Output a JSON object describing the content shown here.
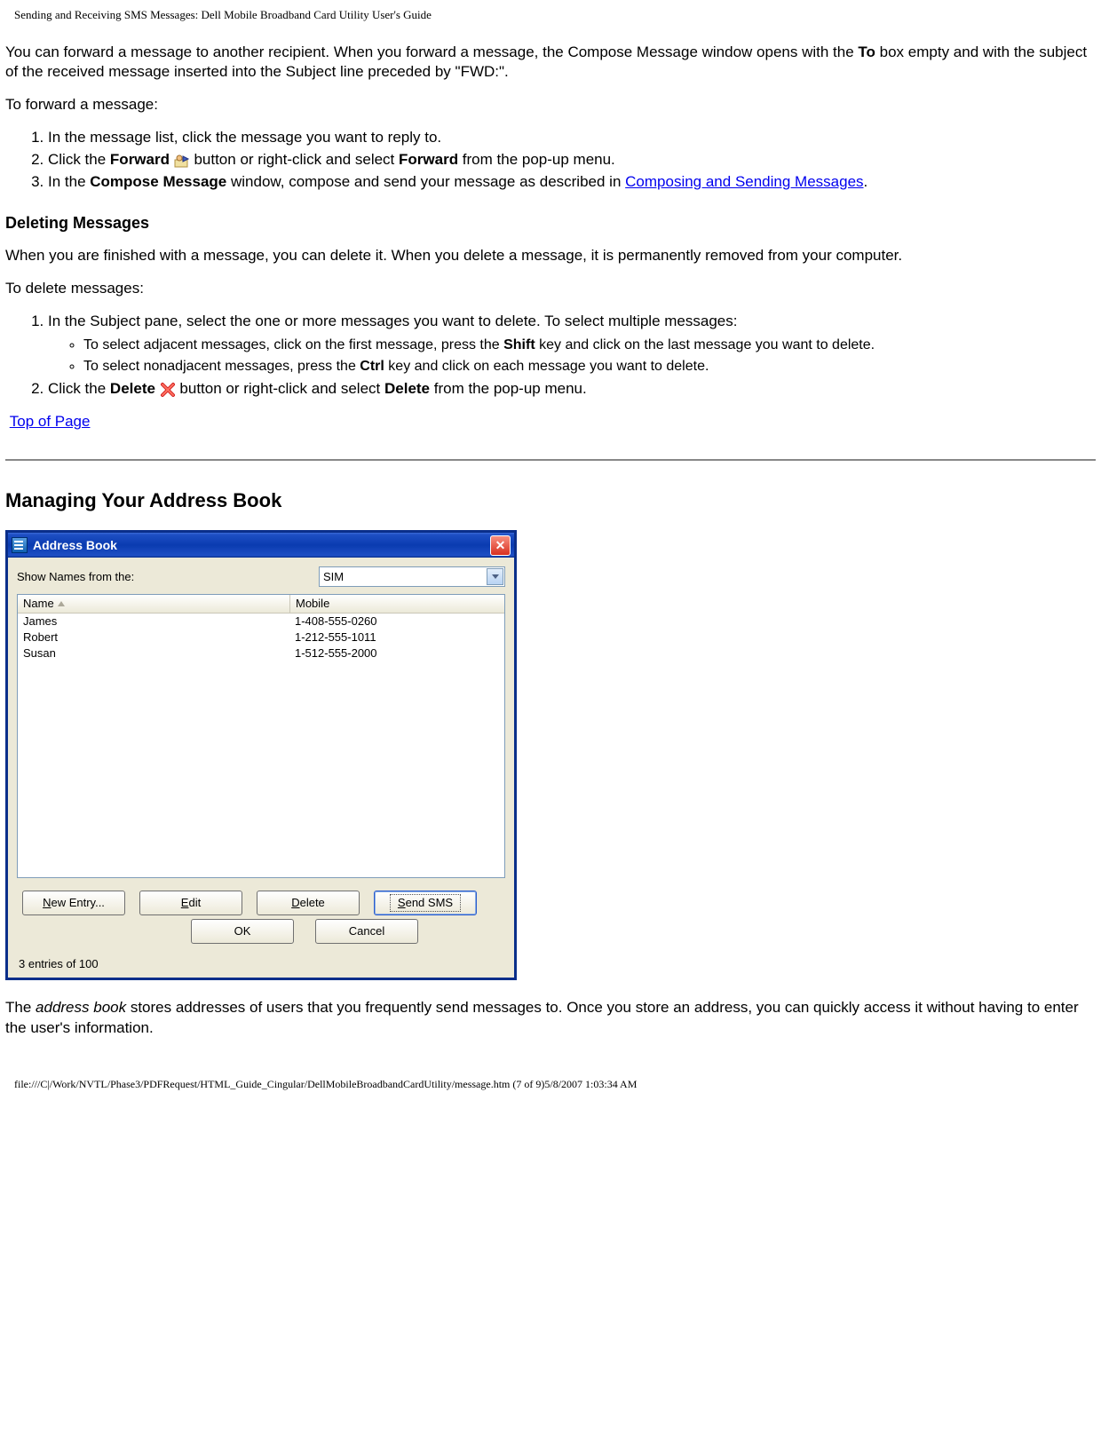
{
  "header": "Sending and Receiving SMS Messages: Dell Mobile Broadband Card Utility User's Guide",
  "p1_1": "You can forward a message to another recipient. When you forward a message, the Compose Message window opens with the ",
  "p1_bold": "To",
  "p1_2": " box empty and with the subject of the received message inserted into the Subject line preceded by \"FWD:\".",
  "p2": "To forward a message:",
  "fwd_steps": {
    "s1": "In the message list, click the message you want to reply to.",
    "s2_a": "Click the ",
    "s2_b1": "Forward",
    "s2_c": " button or right-click and select ",
    "s2_b2": "Forward",
    "s2_d": " from the pop-up menu.",
    "s3_a": "In the ",
    "s3_b": "Compose Message",
    "s3_c": " window, compose and send your message as described in ",
    "s3_link": "Composing and Sending Messages",
    "s3_d": "."
  },
  "h_delete": "Deleting Messages",
  "del_p1": "When you are finished with a message, you can delete it. When you delete a message, it is permanently removed from your computer.",
  "del_p2": "To delete messages:",
  "del_steps": {
    "s1": "In the Subject pane, select the one or more messages you want to delete. To select multiple messages:",
    "s1a_1": "To select adjacent messages, click on the first message, press the ",
    "s1a_b": "Shift",
    "s1a_2": " key and click on the last message you want to delete.",
    "s1b_1": "To select nonadjacent messages, press the ",
    "s1b_b": "Ctrl",
    "s1b_2": " key and click on each message you want to delete.",
    "s2_a": "Click the ",
    "s2_b1": "Delete",
    "s2_c": " button or right-click and select ",
    "s2_b2": "Delete",
    "s2_d": " from the pop-up menu."
  },
  "top_link": "Top of Page",
  "h_addressbook": "Managing Your Address Book",
  "ab": {
    "title": "Address Book",
    "show_label": "Show Names from the:",
    "select_val": "SIM",
    "col_name": "Name",
    "col_mobile": "Mobile",
    "rows": [
      {
        "name": "James",
        "mobile": "1-408-555-0260"
      },
      {
        "name": "Robert",
        "mobile": "1-212-555-1011"
      },
      {
        "name": "Susan",
        "mobile": "1-512-555-2000"
      }
    ],
    "btn_new_u": "N",
    "btn_new": "ew Entry...",
    "btn_edit_u": "E",
    "btn_edit": "dit",
    "btn_delete_u": "D",
    "btn_delete": "elete",
    "btn_send_u": "S",
    "btn_send": "end SMS",
    "btn_ok": "OK",
    "btn_cancel": "Cancel",
    "status": "3 entries of 100"
  },
  "p_after_1": "The ",
  "p_after_i": "address book",
  "p_after_2": " stores addresses of users that you frequently send messages to. Once you store an address, you can quickly access it without having to enter the user's information.",
  "footer": "file:///C|/Work/NVTL/Phase3/PDFRequest/HTML_Guide_Cingular/DellMobileBroadbandCardUtility/message.htm (7 of 9)5/8/2007 1:03:34 AM"
}
